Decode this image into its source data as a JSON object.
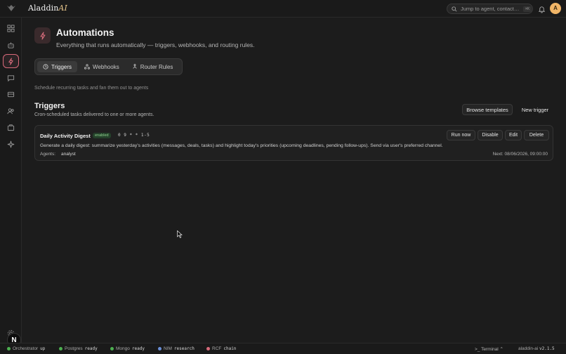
{
  "app": {
    "brand_prefix": "Aladdin",
    "brand_suffix": "AI",
    "search_placeholder": "Jump to agent, contact…",
    "search_kbd": "⌘K",
    "avatar_initial": "A"
  },
  "page": {
    "title": "Automations",
    "subtitle": "Everything that runs automatically — triggers, webhooks, and routing rules.",
    "tabs": [
      {
        "label": "Triggers",
        "icon": "clock-icon",
        "active": true
      },
      {
        "label": "Webhooks",
        "icon": "webhook-icon",
        "active": false
      },
      {
        "label": "Router Rules",
        "icon": "router-icon",
        "active": false
      }
    ],
    "hint": "Schedule recurring tasks and fan them out to agents"
  },
  "section": {
    "title": "Triggers",
    "subtitle": "Cron-scheduled tasks delivered to one or more agents.",
    "browse_label": "Browse templates",
    "new_label": "New trigger"
  },
  "trigger": {
    "name": "Daily Activity Digest",
    "status": "enabled",
    "cron": "0 9 * * 1-5",
    "description": "Generate a daily digest: summarize yesterday's activities (messages, deals, tasks) and highlight today's priorities (upcoming deadlines, pending follow-ups). Send via user's preferred channel.",
    "agents_label": "Agents:",
    "agent": "analyst",
    "next": "Next: 08/06/2026, 09:00:00",
    "actions": {
      "run": "Run now",
      "disable": "Disable",
      "edit": "Edit",
      "delete": "Delete"
    }
  },
  "statusbar": {
    "items": [
      {
        "label": "Orchestrator",
        "value": "up",
        "color": "#4caf50"
      },
      {
        "label": "Postgres",
        "value": "ready",
        "color": "#4caf50"
      },
      {
        "label": "Mongo",
        "value": "ready",
        "color": "#4caf50"
      },
      {
        "label": "NIM",
        "value": "research",
        "color": "#6a8fd8"
      },
      {
        "label": "RCF",
        "value": "chain",
        "color": "#d86a7a"
      }
    ],
    "terminal": "Terminal",
    "version_label": "aladdin-ai",
    "version": "v2.1.5"
  },
  "colors": {
    "accent": "#d86a7a",
    "avatar": "#f0b567",
    "enabled": "#8ed08e"
  }
}
